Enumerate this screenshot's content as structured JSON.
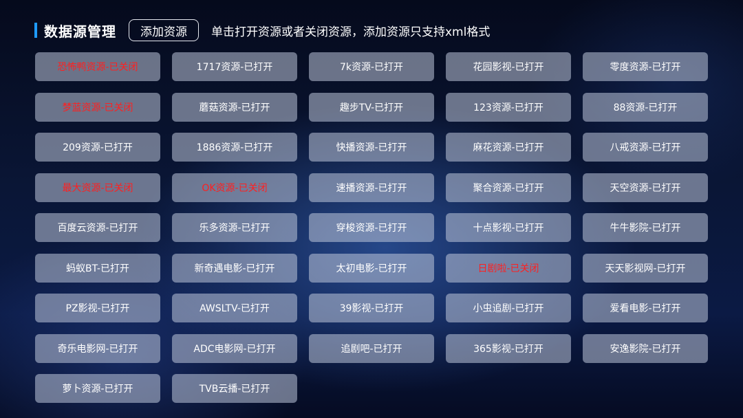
{
  "header": {
    "title": "数据源管理",
    "add_button_label": "添加资源",
    "hint": "单击打开资源或者关闭资源，添加资源只支持xml格式"
  },
  "colors": {
    "accent": "#1e9bff",
    "closed_text": "#ff1f1f",
    "open_text": "#ffffff"
  },
  "sources": [
    {
      "label": "恐怖鸭资源-已关闭",
      "status": "closed"
    },
    {
      "label": "1717资源-已打开",
      "status": "open"
    },
    {
      "label": "7k资源-已打开",
      "status": "open"
    },
    {
      "label": "花园影视-已打开",
      "status": "open"
    },
    {
      "label": "零度资源-已打开",
      "status": "open"
    },
    {
      "label": "梦蓝资源-已关闭",
      "status": "closed"
    },
    {
      "label": "蘑菇资源-已打开",
      "status": "open"
    },
    {
      "label": "趣步TV-已打开",
      "status": "open"
    },
    {
      "label": "123资源-已打开",
      "status": "open"
    },
    {
      "label": "88资源-已打开",
      "status": "open"
    },
    {
      "label": "209资源-已打开",
      "status": "open"
    },
    {
      "label": "1886资源-已打开",
      "status": "open"
    },
    {
      "label": "快播资源-已打开",
      "status": "open"
    },
    {
      "label": "麻花资源-已打开",
      "status": "open"
    },
    {
      "label": "八戒资源-已打开",
      "status": "open"
    },
    {
      "label": "最大资源-已关闭",
      "status": "closed"
    },
    {
      "label": "OK资源-已关闭",
      "status": "closed"
    },
    {
      "label": "速播资源-已打开",
      "status": "open"
    },
    {
      "label": "聚合资源-已打开",
      "status": "open"
    },
    {
      "label": "天空资源-已打开",
      "status": "open"
    },
    {
      "label": "百度云资源-已打开",
      "status": "open"
    },
    {
      "label": "乐多资源-已打开",
      "status": "open"
    },
    {
      "label": "穿梭资源-已打开",
      "status": "open"
    },
    {
      "label": "十点影视-已打开",
      "status": "open"
    },
    {
      "label": "牛牛影院-已打开",
      "status": "open"
    },
    {
      "label": "蚂蚁BT-已打开",
      "status": "open"
    },
    {
      "label": "新奇遇电影-已打开",
      "status": "open"
    },
    {
      "label": "太初电影-已打开",
      "status": "open"
    },
    {
      "label": "日剧啦-已关闭",
      "status": "closed"
    },
    {
      "label": "天天影视网-已打开",
      "status": "open"
    },
    {
      "label": "PZ影视-已打开",
      "status": "open"
    },
    {
      "label": "AWSLTV-已打开",
      "status": "open"
    },
    {
      "label": "39影视-已打开",
      "status": "open"
    },
    {
      "label": "小虫追剧-已打开",
      "status": "open"
    },
    {
      "label": "爱看电影-已打开",
      "status": "open"
    },
    {
      "label": "奇乐电影网-已打开",
      "status": "open"
    },
    {
      "label": "ADC电影网-已打开",
      "status": "open"
    },
    {
      "label": "追剧吧-已打开",
      "status": "open"
    },
    {
      "label": "365影视-已打开",
      "status": "open"
    },
    {
      "label": "安逸影院-已打开",
      "status": "open"
    },
    {
      "label": "萝卜资源-已打开",
      "status": "open"
    },
    {
      "label": "TVB云播-已打开",
      "status": "open"
    }
  ]
}
